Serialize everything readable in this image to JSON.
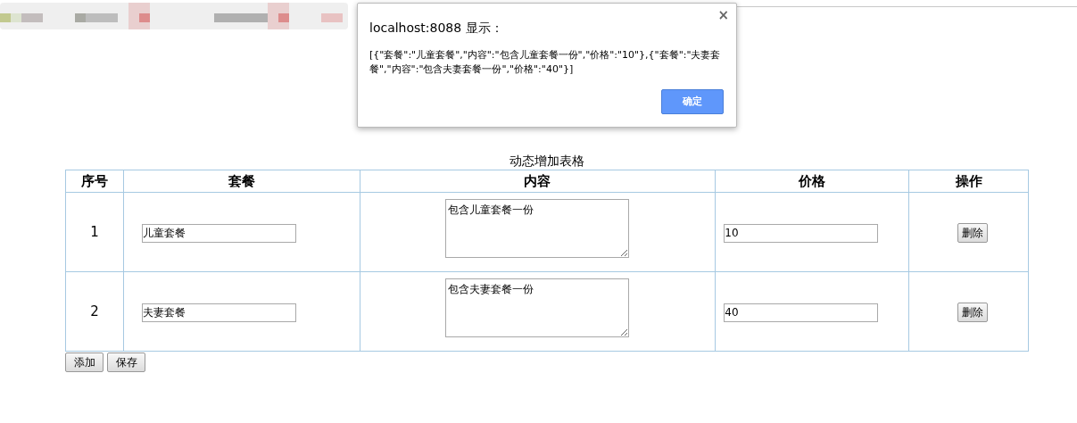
{
  "caption": "动态增加表格",
  "table": {
    "columns": [
      "序号",
      "套餐",
      "内容",
      "价格",
      "操作"
    ],
    "rows": [
      {
        "index": "1",
        "meal": "儿童套餐",
        "content": "包含儿童套餐一份",
        "price": "10",
        "action": "删除"
      },
      {
        "index": "2",
        "meal": "夫妻套餐",
        "content": "包含夫妻套餐一份",
        "price": "40",
        "action": "删除"
      }
    ]
  },
  "buttons": [
    "添加",
    "保存"
  ],
  "dialog": {
    "title": "localhost:8088 显示：",
    "close": "×",
    "message": "[{\"套餐\":\"儿童套餐\",\"内容\":\"包含儿童套餐一份\",\"价格\":\"10\"},{\"套餐\":\"夫妻套餐\",\"内容\":\"包含夫妻套餐一份\",\"价格\":\"40\"}]",
    "ok": "确定"
  }
}
